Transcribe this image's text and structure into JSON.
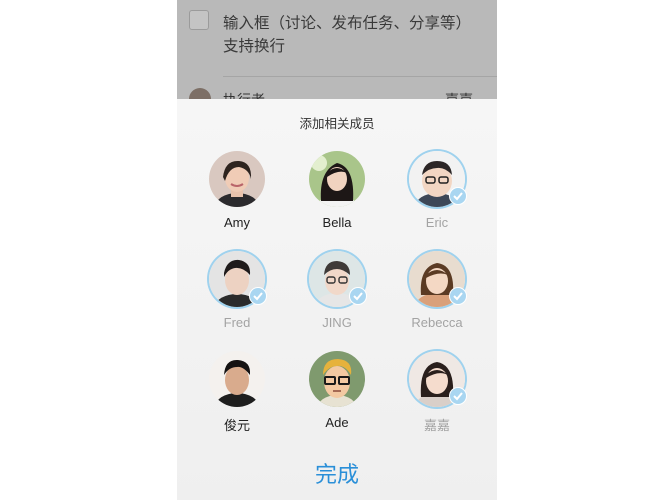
{
  "background": {
    "input_text": "输入框（讨论、发布任务、分享等）支持换行",
    "row_label": "执行者",
    "row_value": "嘉嘉"
  },
  "sheet": {
    "title": "添加相关成员",
    "done_label": "完成"
  },
  "members": [
    {
      "name": "Amy",
      "selected": false
    },
    {
      "name": "Bella",
      "selected": false
    },
    {
      "name": "Eric",
      "selected": true
    },
    {
      "name": "Fred",
      "selected": true
    },
    {
      "name": "JING",
      "selected": true
    },
    {
      "name": "Rebecca",
      "selected": true
    },
    {
      "name": "俊元",
      "selected": false
    },
    {
      "name": "Ade",
      "selected": false
    },
    {
      "name": "嘉嘉",
      "selected": true
    }
  ],
  "colors": {
    "accent": "#2a8fd8",
    "selected_ring": "#9fd2ee",
    "check_badge": "#a9d6f1"
  }
}
